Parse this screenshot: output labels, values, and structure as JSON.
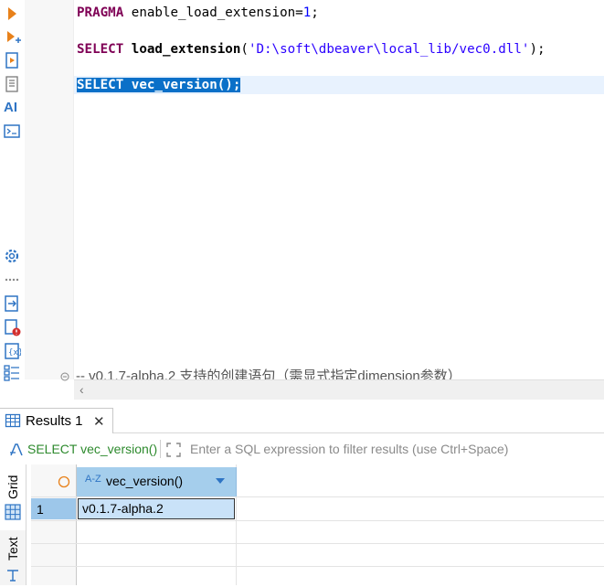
{
  "editor": {
    "line1": {
      "kw": "PRAGMA",
      "rest": " enable_load_extension=",
      "num": "1",
      "end": ";"
    },
    "line2": {
      "kw": "SELECT",
      "fn": "load_extension",
      "open": "(",
      "str": "'D:\\soft\\dbeaver\\local_lib/vec0.dll'",
      "end": ");"
    },
    "line3": {
      "text": "SELECT vec_version();"
    },
    "cut_comment": "-- v0.1.7-alpha.2 支持的创建语句（需显式指定dimension参数）",
    "ai_label": "AI"
  },
  "toolbar_icons": [
    "execute-icon",
    "execute-new-tab-icon",
    "execute-script-icon",
    "explain-icon",
    "ai-icon",
    "terminal-icon",
    "settings-icon",
    "more-icon",
    "export-icon",
    "error-log-icon",
    "variables-icon",
    "outline-icon"
  ],
  "results": {
    "tab_label": "Results 1",
    "filter_query": "SELECT vec_version()",
    "filter_placeholder": "Enter a SQL expression to filter results (use Ctrl+Space)",
    "vtab_grid": "Grid",
    "vtab_text": "Text",
    "column_type": "A-Z",
    "columns": [
      "vec_version()"
    ],
    "rows": [
      {
        "num": "1",
        "cells": [
          "v0.1.7-alpha.2"
        ]
      }
    ]
  },
  "colors": {
    "selection": "#0a70c8",
    "column_header": "#a5ceec",
    "keyword": "#7f0055",
    "filter_query": "#2d8a2d"
  }
}
